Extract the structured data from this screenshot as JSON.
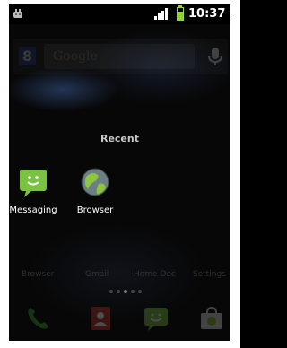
{
  "statusbar": {
    "time": "10:37 AM",
    "battery_level": 0.7
  },
  "search_widget": {
    "placeholder": "Google",
    "logo_glyph": "8"
  },
  "recent": {
    "title": "Recent",
    "apps": [
      {
        "label": "Messaging",
        "icon": "messaging-icon",
        "color": "#7cc242"
      },
      {
        "label": "Browser",
        "icon": "browser-globe-icon",
        "color": "#5a8a3a"
      }
    ]
  },
  "home_shortcuts": [
    "Browser",
    "Gmail",
    "Home Dec",
    "Settings"
  ],
  "dock": {
    "items": [
      {
        "icon": "phone-icon",
        "color": "#3aa53a"
      },
      {
        "icon": "contacts-icon",
        "color": "#c0392b"
      },
      {
        "icon": "messaging-icon",
        "color": "#7cc242"
      },
      {
        "icon": "market-icon",
        "color": "#8dbf3a"
      }
    ]
  }
}
